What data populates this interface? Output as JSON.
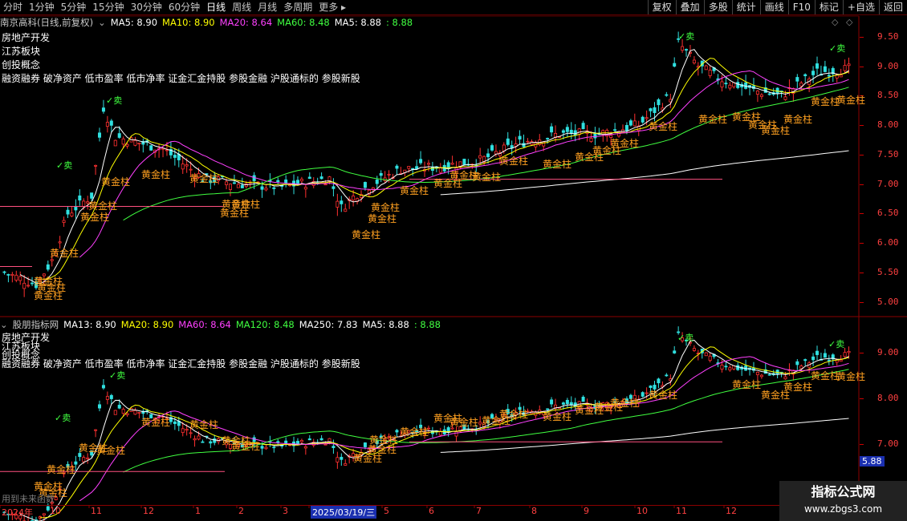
{
  "toolbar": {
    "periods": [
      "分时",
      "1分钟",
      "5分钟",
      "15分钟",
      "30分钟",
      "60分钟",
      "日线",
      "周线",
      "月线",
      "多周期",
      "更多 ▸"
    ],
    "active_period": "日线",
    "buttons": [
      "复权",
      "叠加",
      "多股",
      "统计",
      "画线",
      "F10",
      "标记",
      "+自选",
      "返回"
    ]
  },
  "colors": {
    "ma5": "#ffffff",
    "ma10": "#ffff00",
    "ma20": "#ff40ff",
    "ma60": "#40ff40",
    "ma250": "#ffffff",
    "axis": "#ff4040",
    "gold": "#ffa020",
    "sell": "#40ff40",
    "up": "#ff3030",
    "down": "#30e0e0"
  },
  "top_panel": {
    "stock_label": "南京高科(日线,前复权)",
    "ma_items": [
      {
        "text": "MA5: 8.90",
        "color": "#ffffff"
      },
      {
        "text": "MA10: 8.90",
        "color": "#ffff00"
      },
      {
        "text": "MA20: 8.64",
        "color": "#ff40ff"
      },
      {
        "text": "MA60: 8.48",
        "color": "#40ff40"
      },
      {
        "text": "MA5: 8.88",
        "color": "#ffffff"
      },
      {
        "text": ": 8.88",
        "color": "#40ff40"
      }
    ],
    "concepts": [
      "房地产开发",
      "江苏板块",
      "创投概念",
      "融资融券 破净资产 低市盈率 低市净率 证金汇金持股 参股金融 沪股通标的 参股新股"
    ],
    "ticks": [
      "9.50",
      "9.00",
      "8.50",
      "8.00",
      "7.50",
      "7.00",
      "6.50",
      "6.00",
      "5.50",
      "5.00"
    ]
  },
  "bottom_panel": {
    "indicator_label": "股朋指标网",
    "ma_items": [
      {
        "text": "MA13: 8.90",
        "color": "#ffffff"
      },
      {
        "text": "MA20: 8.90",
        "color": "#ffff00"
      },
      {
        "text": "MA60: 8.64",
        "color": "#ff40ff"
      },
      {
        "text": "MA120: 8.48",
        "color": "#40ff40"
      },
      {
        "text": "MA250: 7.83",
        "color": "#ffffff"
      },
      {
        "text": "MA5: 8.88",
        "color": "#ffffff"
      },
      {
        "text": ": 8.88",
        "color": "#40ff40"
      }
    ],
    "concepts": [
      "房地产开发",
      "江苏板块",
      "创投概念",
      "融资融券 破净资产 低市盈率 低市净率 证金汇金持股 参股金融 沪股通标的 参股新股"
    ],
    "ticks": [
      "9.00",
      "8.00",
      "7.00"
    ],
    "price_tag": "5.88",
    "note": "用到未来函数"
  },
  "xaxis": {
    "labels": [
      "2024年",
      "10",
      "11",
      "12",
      "1",
      "2",
      "3",
      "2025/03/19/三",
      "5",
      "6",
      "7",
      "8",
      "9",
      "10",
      "11",
      "12"
    ],
    "cursor_date": "2025/03/19/三"
  },
  "signals": {
    "gold_text": "黄金柱",
    "sell_text": "卖"
  },
  "watermark": {
    "line1": "指标公式网",
    "line2": "www.zbgs3.com"
  }
}
